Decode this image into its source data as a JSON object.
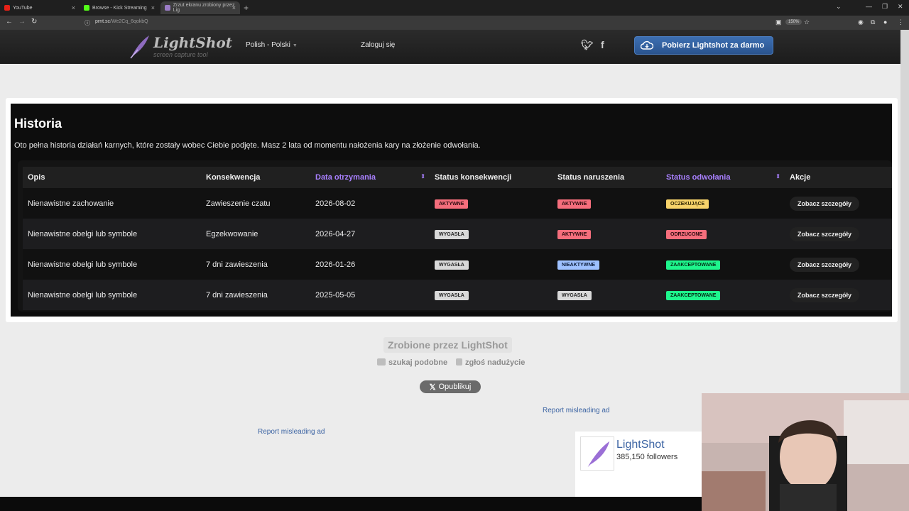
{
  "browser": {
    "tabs": [
      {
        "label": "YouTube",
        "favicon_color": "#e62117"
      },
      {
        "label": "Browse - Kick Streaming",
        "favicon_color": "#53fc18"
      },
      {
        "label": "Zrzut ekranu zrobiony przez Lig",
        "favicon_color": "#9b7cc6"
      }
    ],
    "url_main": "prnt.sc",
    "url_rest": "/We2Cq_6qokbQ",
    "zoom": "150%"
  },
  "header": {
    "logo_text": "LightShot",
    "logo_sub": "screen capture tool",
    "language": "Polish - Polski",
    "login": "Zaloguj się",
    "download": "Pobierz Lightshot za darmo"
  },
  "screenshot": {
    "title": "Historia",
    "description": "Oto pełna historia działań karnych, które zostały wobec Ciebie podjęte. Masz 2 lata od momentu nałożenia kary na złożenie odwołania.",
    "columns": [
      "Opis",
      "Konsekwencja",
      "Data otrzymania",
      "Status konsekwencji",
      "Status naruszenia",
      "Status odwołania",
      "Akcje"
    ],
    "rows": [
      {
        "opis": "Nienawistne zachowanie",
        "konsekwencja": "Zawieszenie czatu",
        "data": "2026-08-02",
        "status_konsekwencji": "AKTYWNE",
        "status_naruszenia": "AKTYWNE",
        "status_odwolania": "OCZEKUJĄCE",
        "akcja": "Zobacz szczegóły"
      },
      {
        "opis": "Nienawistne obelgi lub symbole",
        "konsekwencja": "Egzekwowanie",
        "data": "2026-04-27",
        "status_konsekwencji": "WYGASŁA",
        "status_naruszenia": "AKTYWNE",
        "status_odwolania": "ODRZUCONE",
        "akcja": "Zobacz szczegóły"
      },
      {
        "opis": "Nienawistne obelgi lub symbole",
        "konsekwencja": "7 dni zawieszenia",
        "data": "2026-01-26",
        "status_konsekwencji": "WYGASŁA",
        "status_naruszenia": "NIEAKTYWNE",
        "status_odwolania": "ZAAKCEPTOWANE",
        "akcja": "Zobacz szczegóły"
      },
      {
        "opis": "Nienawistne obelgi lub symbole",
        "konsekwencja": "7 dni zawieszenia",
        "data": "2025-05-05",
        "status_konsekwencji": "WYGASŁA",
        "status_naruszenia": "WYGASŁA",
        "status_odwolania": "ZAAKCEPTOWANE",
        "akcja": "Zobacz szczegóły"
      }
    ]
  },
  "footer": {
    "made_by": "Zrobione przez LightShot",
    "search_similar": "szukaj podobne",
    "report_abuse": "zgłoś nadużycie",
    "publish": "Opublikuj",
    "ad_link_1": "Report misleading ad",
    "ad_link_2": "Report misleading ad",
    "fb_name": "LightShot",
    "fb_followers": "385,150 followers"
  },
  "colors": {
    "accent_purple": "#a980ff",
    "download_blue": "#3d6fb2",
    "badge_red": "#f56e7c",
    "badge_green": "#1ef58c",
    "badge_yellow": "#f7d36a",
    "badge_blue": "#9ec1ff"
  }
}
